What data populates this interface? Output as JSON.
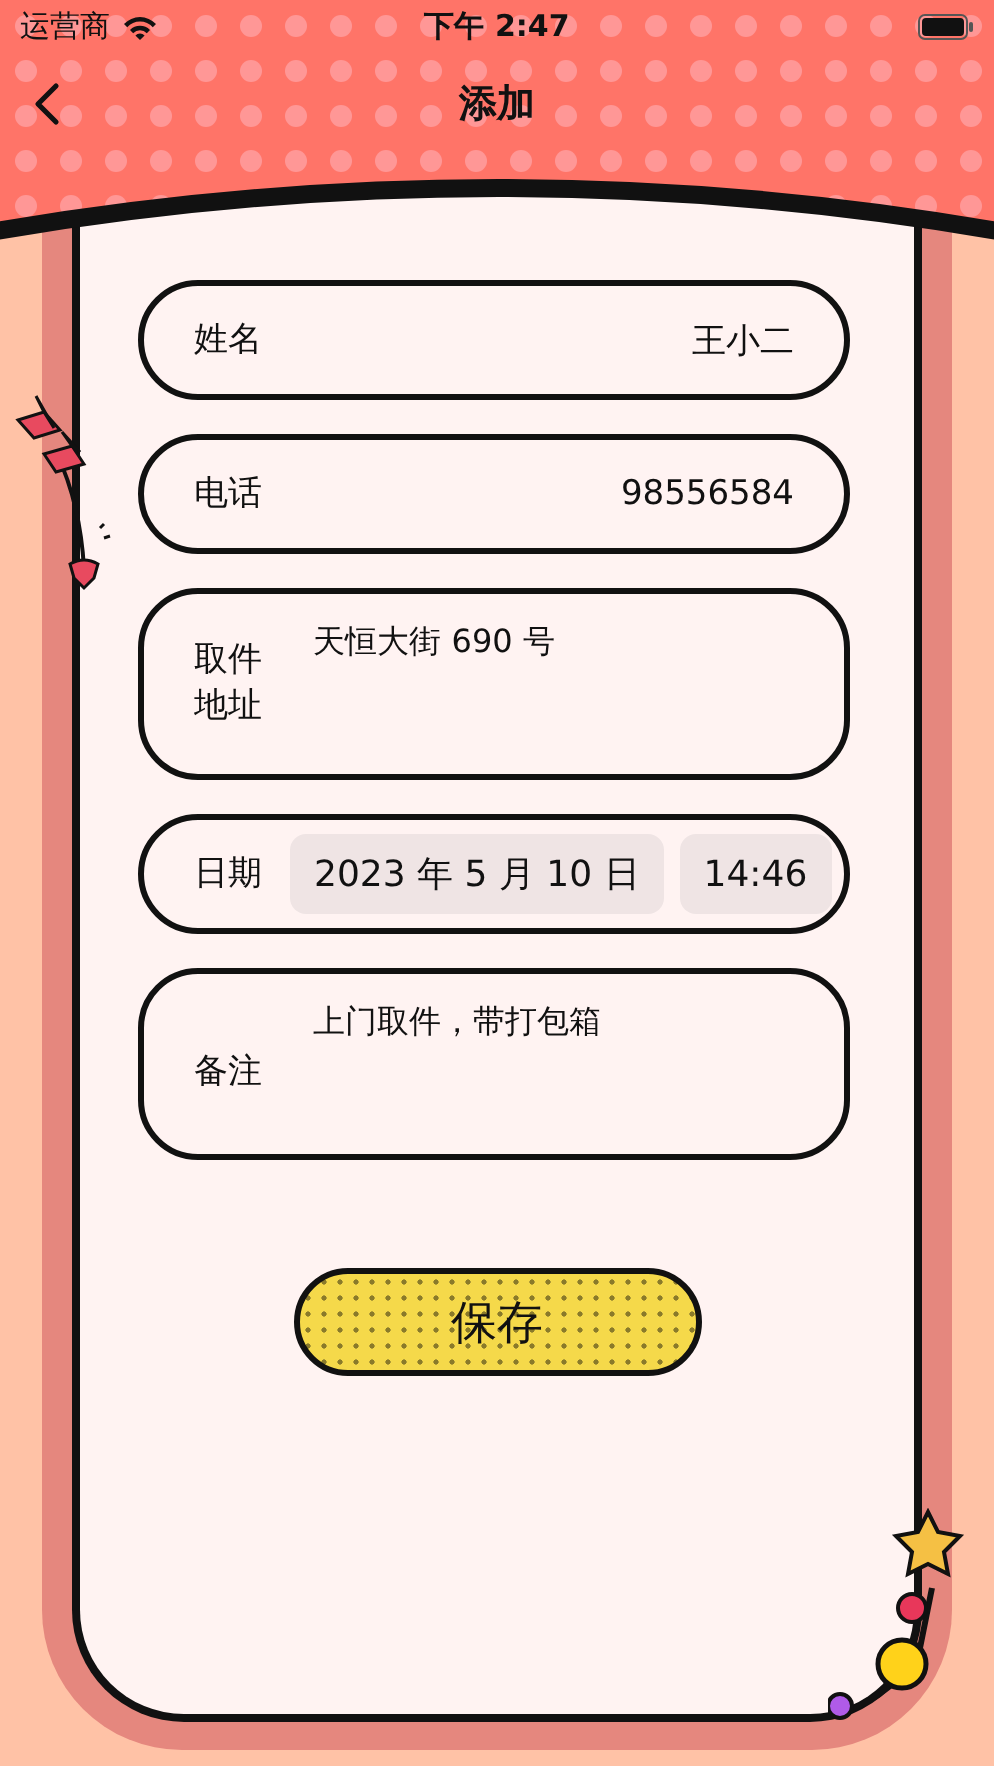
{
  "status_bar": {
    "carrier": "运营商",
    "time": "下午 2:47"
  },
  "nav": {
    "title": "添加"
  },
  "fields": [
    {
      "kind": "inline",
      "label": "姓名",
      "value": "王小二"
    },
    {
      "kind": "inline",
      "label": "电话",
      "value": "98556584"
    },
    {
      "kind": "multiline",
      "label": "取件地址",
      "value": "天恒大街 690 号"
    },
    {
      "kind": "datetime",
      "label": "日期",
      "date": "2023 年 5 月 10 日",
      "time": "14:46"
    },
    {
      "kind": "multiline",
      "label": "备注",
      "value": "上门取件，带打包箱"
    }
  ],
  "save_button": "保存"
}
